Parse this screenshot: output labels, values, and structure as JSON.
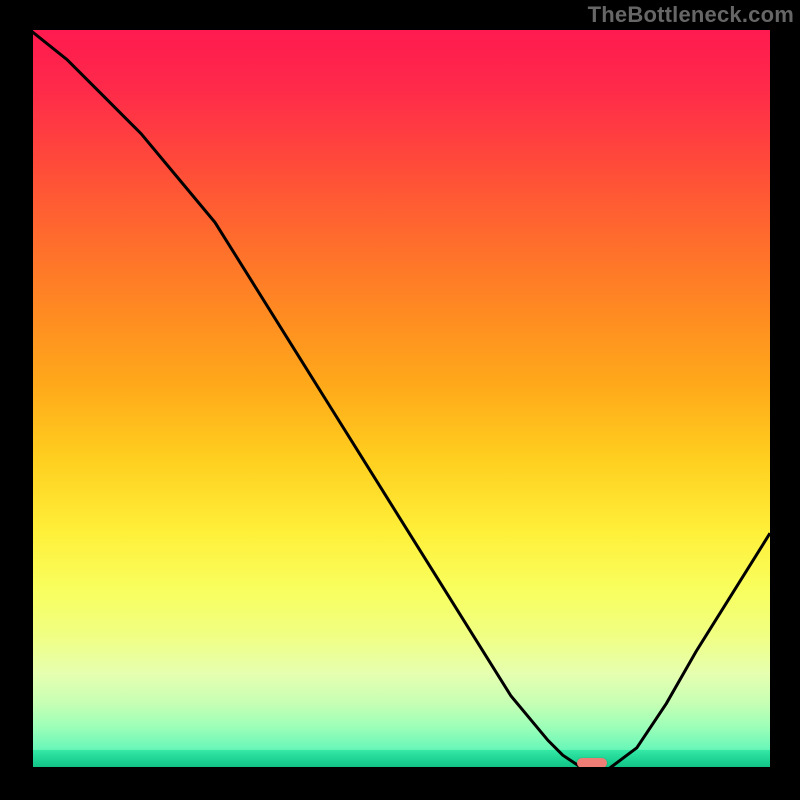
{
  "watermark": "TheBottleneck.com",
  "chart_data": {
    "type": "line",
    "title": "",
    "xlabel": "",
    "ylabel": "",
    "xlim": [
      0,
      100
    ],
    "ylim": [
      0,
      100
    ],
    "grid": false,
    "legend": {
      "visible": false
    },
    "series": [
      {
        "name": "bottleneck-curve",
        "color": "#000000",
        "x": [
          0,
          5,
          10,
          15,
          20,
          25,
          30,
          35,
          40,
          45,
          50,
          55,
          60,
          65,
          70,
          72,
          75,
          78,
          82,
          86,
          90,
          95,
          100
        ],
        "values": [
          100,
          96,
          91,
          86,
          80,
          74,
          66,
          58,
          50,
          42,
          34,
          26,
          18,
          10,
          4,
          2,
          0,
          0,
          3,
          9,
          16,
          24,
          32
        ]
      }
    ],
    "annotations": [
      {
        "name": "optimal-marker",
        "x": 76,
        "y": 1,
        "color": "#ee7d75"
      }
    ],
    "background_gradient": {
      "type": "vertical",
      "stops": [
        {
          "pos": 0,
          "color": "#ff1a4f"
        },
        {
          "pos": 50,
          "color": "#ffcf1f"
        },
        {
          "pos": 80,
          "color": "#f0ff84"
        },
        {
          "pos": 100,
          "color": "#17c98c"
        }
      ]
    }
  }
}
